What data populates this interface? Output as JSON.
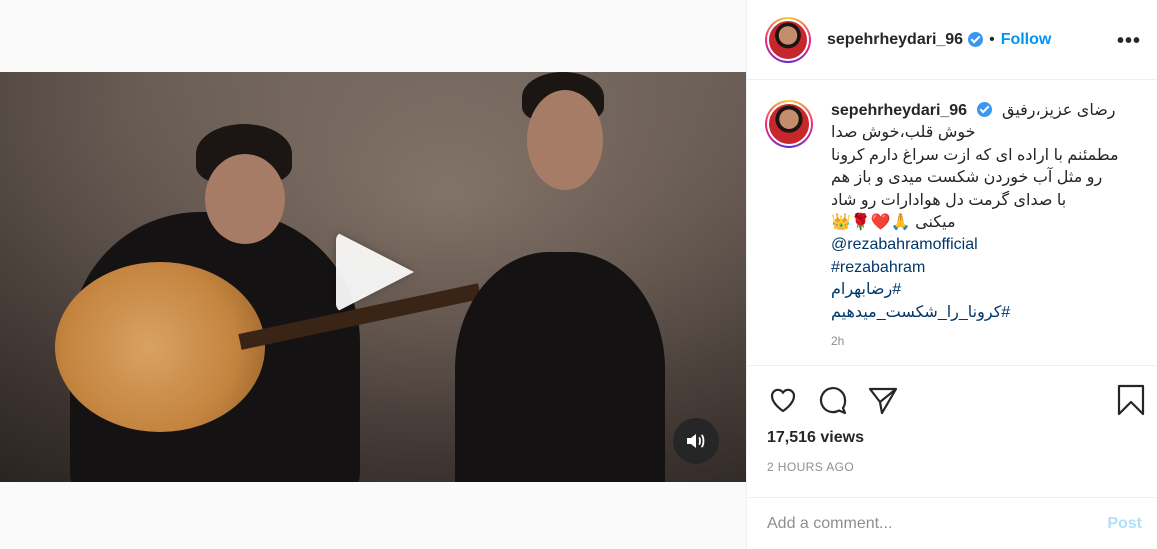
{
  "header": {
    "username": "sepehrheydari_96",
    "separator": "•",
    "follow_label": "Follow",
    "more_label": "•••"
  },
  "caption": {
    "username": "sepehrheydari_96",
    "lines": [
      "رضای عزیز،رفیق",
      "خوش قلب،خوش صدا",
      "مطمئنم با اراده ای که ازت سراغ دارم کرونا",
      "رو مثل آب خوردن شکست میدی و باز هم",
      "با صدای گرمت دل هوادارات رو شاد",
      "میکنی 🙏❤️🌹👑"
    ],
    "mention": "@rezabahramofficial",
    "hashtags": [
      "#rezabahram",
      "#رضابهرام",
      "#کرونا_را_شکست_میدهیم"
    ],
    "time_small": "2h"
  },
  "stats": {
    "views": "17,516 views",
    "time_ago": "2 HOURS AGO"
  },
  "comment": {
    "placeholder": "Add a comment...",
    "post_label": "Post"
  },
  "icons": {
    "like": "heart-icon",
    "comment": "comment-icon",
    "share": "share-icon",
    "save": "bookmark-icon",
    "sound": "speaker-icon",
    "play": "play-icon",
    "verified": "verified-badge-icon"
  },
  "colors": {
    "follow": "#0095f6",
    "verified": "#3897f0",
    "link": "#00376b",
    "post_disabled": "#b2dffc"
  }
}
